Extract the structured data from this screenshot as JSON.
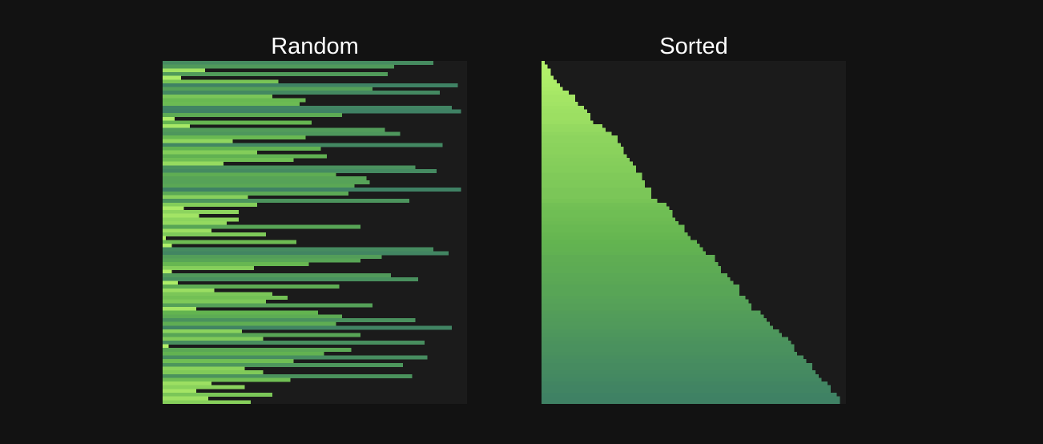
{
  "colors": {
    "background": "#121212",
    "plot_background": "#1b1b1b",
    "title_text": "#ffffff",
    "gradient_low": "#b6f36b",
    "gradient_mid": "#64b550",
    "gradient_high": "#3d7f65"
  },
  "chart_data": [
    {
      "type": "bar",
      "orientation": "horizontal",
      "title": "Random",
      "xlabel": "",
      "ylabel": "",
      "xlim": [
        0,
        100
      ],
      "grid": false,
      "legend": "none",
      "values": [
        89,
        76,
        14,
        74,
        6,
        38,
        97,
        69,
        91,
        36,
        47,
        45,
        95,
        98,
        59,
        4,
        49,
        9,
        73,
        78,
        47,
        23,
        92,
        52,
        31,
        54,
        43,
        20,
        83,
        90,
        57,
        67,
        68,
        63,
        98,
        61,
        28,
        81,
        31,
        7,
        25,
        12,
        25,
        21,
        65,
        16,
        34,
        1,
        44,
        3,
        89,
        94,
        72,
        65,
        48,
        30,
        3,
        75,
        84,
        5,
        58,
        17,
        36,
        41,
        34,
        69,
        11,
        51,
        59,
        83,
        57,
        95,
        26,
        65,
        33,
        86,
        2,
        62,
        53,
        87,
        43,
        79,
        27,
        33,
        82,
        42,
        16,
        27,
        11,
        36,
        15,
        29
      ]
    },
    {
      "type": "bar",
      "orientation": "horizontal",
      "title": "Sorted",
      "xlabel": "",
      "ylabel": "",
      "xlim": [
        0,
        100
      ],
      "grid": false,
      "legend": "none",
      "values": [
        1,
        2,
        3,
        3,
        4,
        5,
        6,
        7,
        9,
        11,
        11,
        12,
        14,
        15,
        16,
        16,
        17,
        20,
        21,
        23,
        25,
        25,
        26,
        27,
        27,
        28,
        29,
        30,
        31,
        31,
        33,
        33,
        34,
        34,
        36,
        36,
        36,
        38,
        41,
        42,
        43,
        43,
        44,
        45,
        47,
        47,
        48,
        49,
        51,
        52,
        53,
        54,
        57,
        57,
        58,
        59,
        59,
        61,
        62,
        63,
        65,
        65,
        65,
        67,
        68,
        69,
        69,
        72,
        73,
        74,
        75,
        76,
        78,
        79,
        81,
        82,
        83,
        83,
        84,
        86,
        87,
        89,
        89,
        90,
        91,
        92,
        94,
        95,
        95,
        97,
        98,
        98
      ]
    }
  ]
}
